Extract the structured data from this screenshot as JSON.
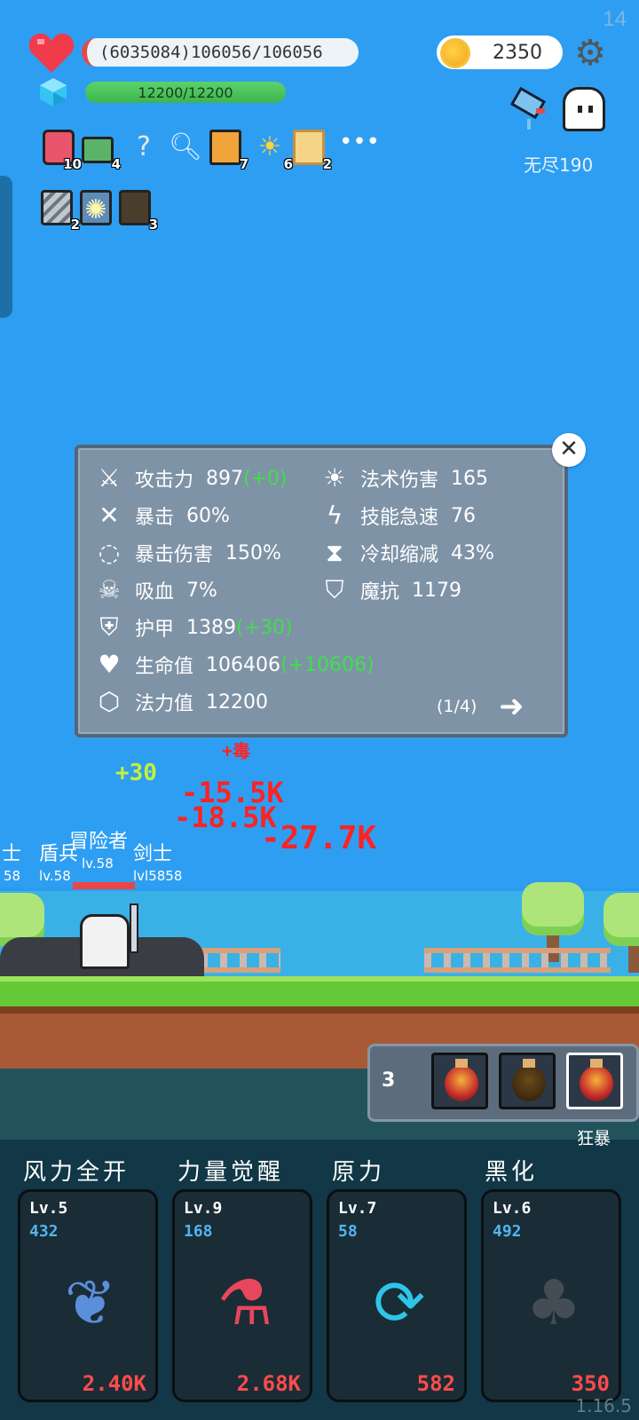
{
  "status": {
    "corner_number": "14",
    "hp_text": "(6035084)106056/106056",
    "mp_text": "12200/12200",
    "gold": "2350",
    "mode_label": "无尽190"
  },
  "inventory": [
    {
      "icon": "jam-jar-icon",
      "count": "10"
    },
    {
      "icon": "cash-heart-icon",
      "count": "4"
    },
    {
      "icon": "hook-icon",
      "count": ""
    },
    {
      "icon": "magnifier-icon",
      "count": ""
    },
    {
      "icon": "book-icon",
      "count": "7"
    },
    {
      "icon": "sun-icon",
      "count": "6"
    },
    {
      "icon": "scroll-icon",
      "count": "2"
    },
    {
      "icon": "more-icon",
      "count": ""
    }
  ],
  "inventory_row2": [
    {
      "icon": "blade-icon",
      "count": "2"
    },
    {
      "icon": "bulb-icon",
      "count": ""
    },
    {
      "icon": "shadow-icon",
      "count": "3"
    }
  ],
  "stats": {
    "page": "(1/4)",
    "items": [
      {
        "label": "攻击力",
        "value": "897",
        "bonus": "(+0)"
      },
      {
        "label": "法术伤害",
        "value": "165",
        "bonus": ""
      },
      {
        "label": "暴击",
        "value": "60%",
        "bonus": ""
      },
      {
        "label": "技能急速",
        "value": "76",
        "bonus": ""
      },
      {
        "label": "暴击伤害",
        "value": "150%",
        "bonus": ""
      },
      {
        "label": "冷却缩减",
        "value": "43%",
        "bonus": ""
      },
      {
        "label": "吸血",
        "value": "7%",
        "bonus": ""
      },
      {
        "label": "魔抗",
        "value": "1179",
        "bonus": ""
      },
      {
        "label": "护甲",
        "value": "1389",
        "bonus": "(+30)"
      },
      {
        "label": "生命值",
        "value": "106406",
        "bonus": "(+10606)"
      },
      {
        "label": "法力值",
        "value": "12200",
        "bonus": ""
      }
    ]
  },
  "battle": {
    "heal_float": "+30",
    "damage_floats": [
      "-15.5K",
      "-18.5K",
      "-27.7K"
    ],
    "poison_text": "+毒",
    "units": [
      {
        "name": "士",
        "level": "58"
      },
      {
        "name": "盾兵",
        "level": "lv.58"
      },
      {
        "name": "冒险者",
        "level": "lv.58"
      },
      {
        "name": "剑士",
        "level": "lv.58"
      }
    ],
    "overlap_level": "lvl5858"
  },
  "potions": {
    "count": "3",
    "active_label": "狂暴"
  },
  "skills": [
    {
      "title": "风力全开",
      "level": "Lv.5",
      "num": "432",
      "cost": "2.40K",
      "icon": "feather-icon"
    },
    {
      "title": "力量觉醒",
      "level": "Lv.9",
      "num": "168",
      "cost": "2.68K",
      "icon": "test-tube-icon"
    },
    {
      "title": "原力",
      "level": "Lv.7",
      "num": "58",
      "cost": "582",
      "icon": "cycle-icon"
    },
    {
      "title": "黑化",
      "level": "Lv.6",
      "num": "492",
      "cost": "350",
      "icon": "dark-tree-icon"
    }
  ],
  "version": "1.16.5"
}
